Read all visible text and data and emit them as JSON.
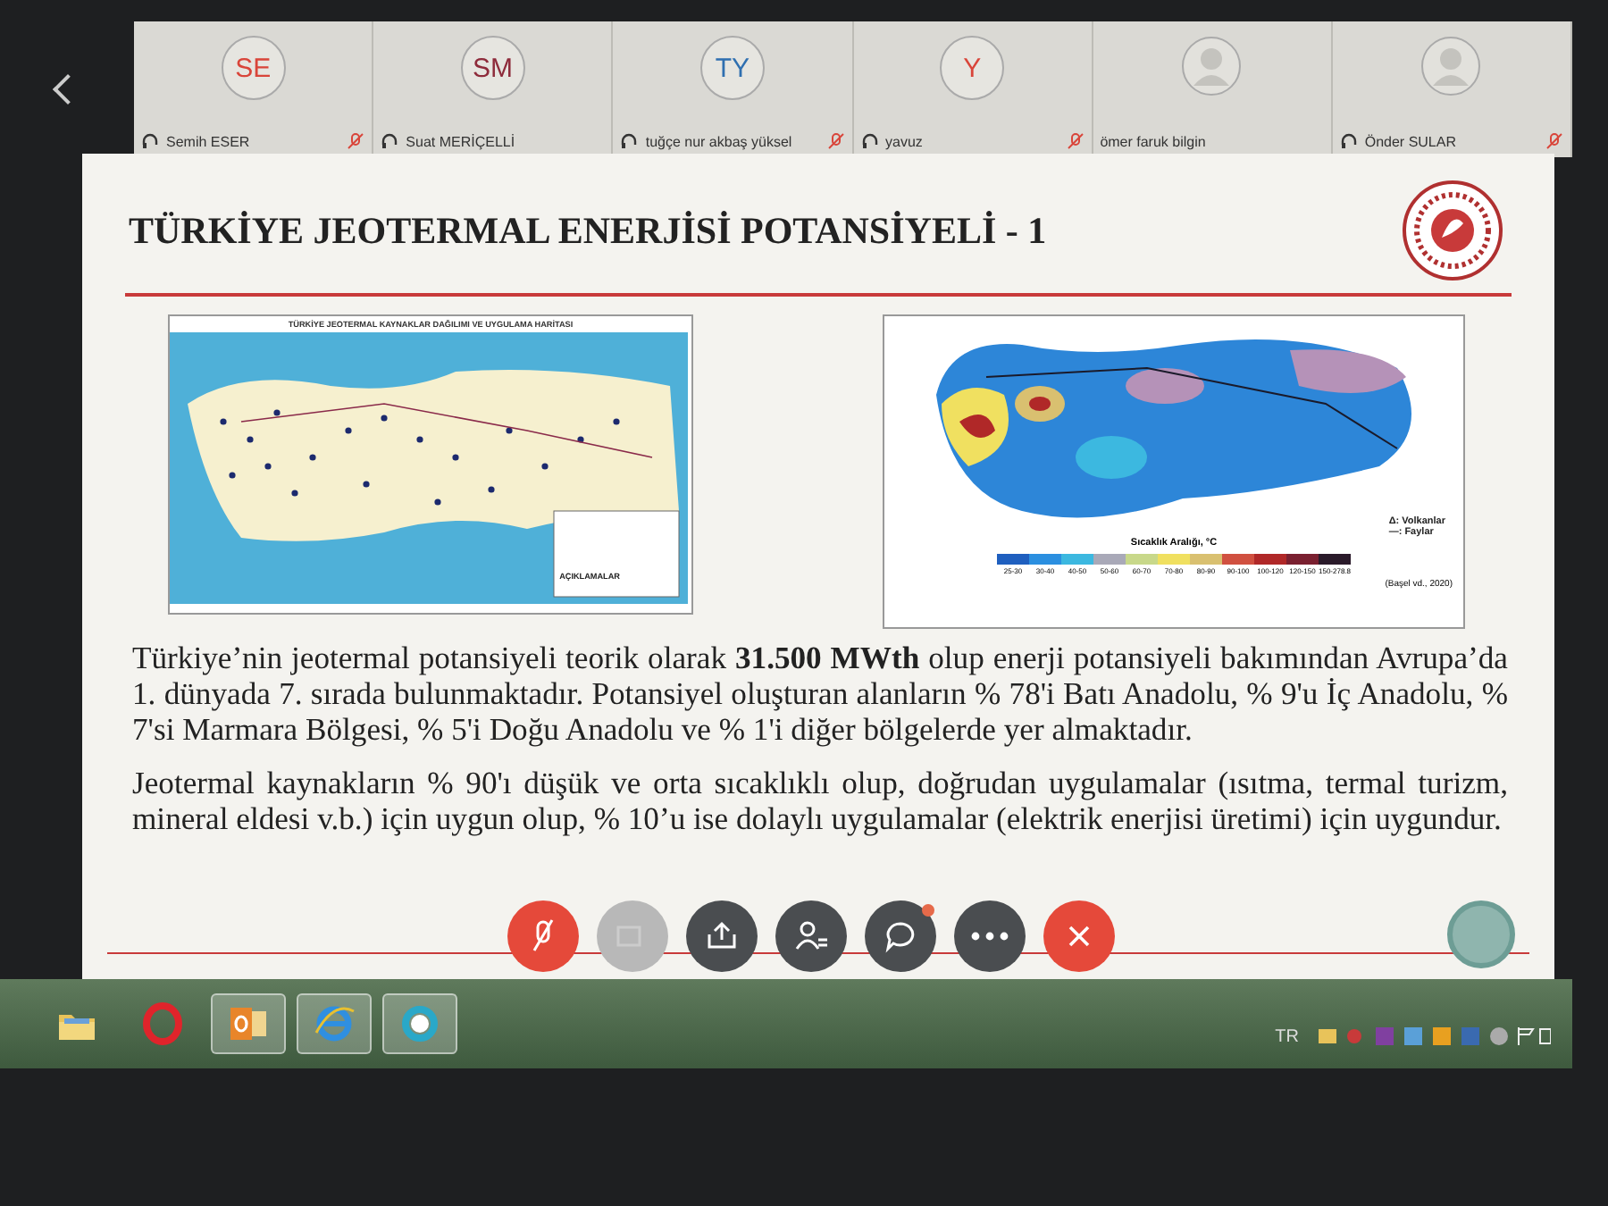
{
  "participants": [
    {
      "name": "Semih ESER",
      "initials": "SE",
      "color": "#d9453a",
      "kind": "initials",
      "audio_connected": true,
      "muted": true
    },
    {
      "name": "Suat MERİÇELLİ",
      "initials": "SM",
      "color": "#8e2b3b",
      "kind": "initials",
      "audio_connected": true,
      "muted": false
    },
    {
      "name": "tuğçe nur akbaş yüksel",
      "initials": "TY",
      "color": "#2f6fb0",
      "kind": "initials",
      "audio_connected": true,
      "muted": true
    },
    {
      "name": "yavuz",
      "initials": "Y",
      "color": "#d9453a",
      "kind": "initials",
      "audio_connected": true,
      "muted": true
    },
    {
      "name": "ömer faruk bilgin",
      "kind": "silhouette",
      "audio_connected": false,
      "muted": false
    },
    {
      "name": "Önder SULAR",
      "kind": "silhouette",
      "audio_connected": true,
      "muted": true
    }
  ],
  "slide": {
    "title": "TÜRKİYE JEOTERMAL ENERJİSİ POTANSİYELİ - 1",
    "left_map": {
      "title": "TÜRKİYE JEOTERMAL KAYNAKLAR DAĞILIMI VE UYGULAMA HARİTASI",
      "legend_title": "AÇIKLAMALAR"
    },
    "right_map": {
      "scale_title": "Sıcaklık Aralığı, °C",
      "scale": [
        {
          "label": "25-30",
          "color": "#1f5fbf"
        },
        {
          "label": "30-40",
          "color": "#2b8fe0"
        },
        {
          "label": "40-50",
          "color": "#3cb8e0"
        },
        {
          "label": "50-60",
          "color": "#a9a9b8"
        },
        {
          "label": "60-70",
          "color": "#c8d88a"
        },
        {
          "label": "70-80",
          "color": "#f0e060"
        },
        {
          "label": "80-90",
          "color": "#d9c070"
        },
        {
          "label": "90-100",
          "color": "#d05040"
        },
        {
          "label": "100-120",
          "color": "#b02828"
        },
        {
          "label": "120-150",
          "color": "#7a2030"
        },
        {
          "label": "150-278.8",
          "color": "#2a1a2a"
        }
      ],
      "legend": [
        "Δ: Volkanlar",
        "—: Faylar"
      ],
      "source": "(Başel vd., 2020)"
    },
    "paragraphs": [
      "Türkiye’nin jeotermal potansiyeli teorik olarak **31.500 MWth** olup enerji potansiyeli bakımından Avrupa’da 1. dünyada 7. sırada bulunmaktadır. Potansiyel oluşturan alanların % 78'i Batı Anadolu, % 9'u İç Anadolu, % 7'si Marmara Bölgesi, % 5'i Doğu Anadolu ve % 1'i diğer bölgelerde yer almaktadır.",
      "Jeotermal kaynakların % 90'ı düşük ve orta sıcaklıklı olup, doğrudan uygulamalar (ısıtma, termal turizm, mineral eldesi v.b.) için uygun olup, % 10’u ise dolaylı uygulamalar (elektrik enerjisi üretimi) için uygundur."
    ]
  },
  "meeting_controls": [
    {
      "kind": "mute",
      "disabled": false,
      "badge": false
    },
    {
      "kind": "video",
      "disabled": true,
      "badge": false
    },
    {
      "kind": "share",
      "disabled": false,
      "badge": false
    },
    {
      "kind": "participants",
      "disabled": false,
      "badge": false
    },
    {
      "kind": "chat",
      "disabled": false,
      "badge": true
    },
    {
      "kind": "more",
      "disabled": false,
      "badge": false
    },
    {
      "kind": "leave",
      "disabled": false,
      "badge": false
    }
  ],
  "taskbar": [
    {
      "kind": "folder",
      "selected": false
    },
    {
      "kind": "opera",
      "selected": false
    },
    {
      "kind": "outlook",
      "selected": true
    },
    {
      "kind": "ie",
      "selected": true
    },
    {
      "kind": "webex",
      "selected": true
    }
  ],
  "tray": {
    "language": "TR"
  }
}
